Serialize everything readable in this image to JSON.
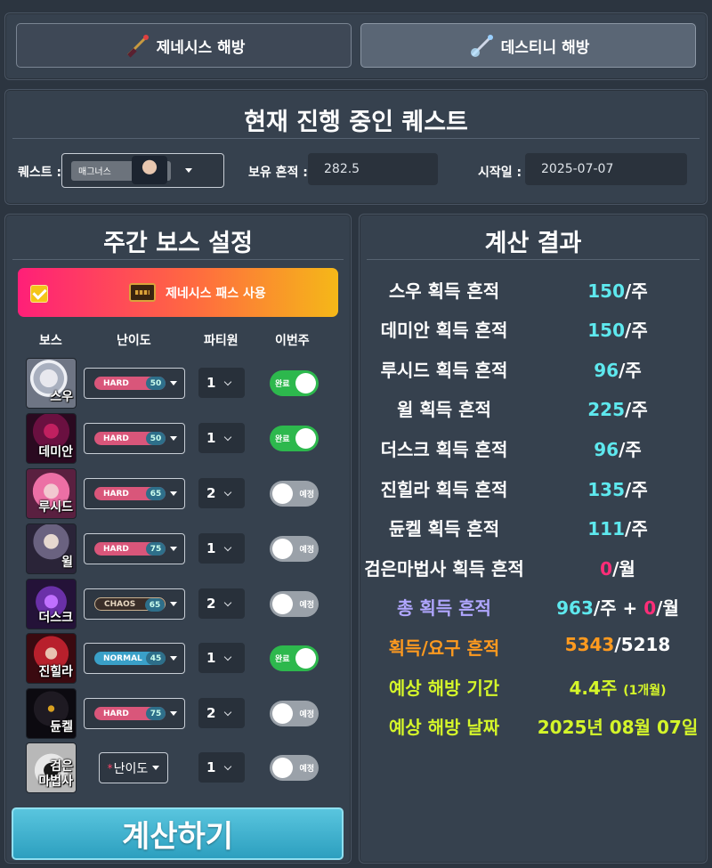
{
  "tabs": [
    {
      "label": "제네시스 해방",
      "icon": "genesis-weapon-icon"
    },
    {
      "label": "데스티니 해방",
      "icon": "destiny-weapon-icon"
    }
  ],
  "quest": {
    "title": "현재 진행 중인 퀘스트",
    "quest_label": "퀘스트 :",
    "quest_value": "매그너스",
    "owned_label": "보유 흔적 :",
    "owned_value": "282.5",
    "start_label": "시작일 :",
    "start_value": "2025-07-07"
  },
  "boss_settings": {
    "title": "주간 보스 설정",
    "genesis_pass_label": "제네시스 패스 사용",
    "genesis_pass_checked": true,
    "col_boss": "보스",
    "col_difficulty": "난이도",
    "col_party": "파티원",
    "col_this_week": "이번주",
    "rows": [
      {
        "name": "스우",
        "difficulty": "HARD",
        "level": "50",
        "party": "1",
        "toggle_label": "완료",
        "done": true
      },
      {
        "name": "데미안",
        "difficulty": "HARD",
        "level": "50",
        "party": "1",
        "toggle_label": "완료",
        "done": true
      },
      {
        "name": "루시드",
        "difficulty": "HARD",
        "level": "65",
        "party": "2",
        "toggle_label": "예정",
        "done": false
      },
      {
        "name": "윌",
        "difficulty": "HARD",
        "level": "75",
        "party": "1",
        "toggle_label": "예정",
        "done": false
      },
      {
        "name": "더스크",
        "difficulty": "CHAOS",
        "level": "65",
        "party": "2",
        "toggle_label": "예정",
        "done": false
      },
      {
        "name": "진힐라",
        "difficulty": "NORMAL",
        "level": "45",
        "party": "1",
        "toggle_label": "완료",
        "done": true
      },
      {
        "name": "듄켈",
        "difficulty": "HARD",
        "level": "75",
        "party": "2",
        "toggle_label": "예정",
        "done": false
      },
      {
        "name": "검은 마법사",
        "name_line1": "검은",
        "name_line2": "마법사",
        "difficulty_placeholder": "난이도",
        "required_mark": "*",
        "party": "1",
        "toggle_label": "예정",
        "done": false
      }
    ],
    "calculate_label": "계산하기"
  },
  "results": {
    "title": "계산 결과",
    "rows": [
      {
        "label": "스우 획득 흔적",
        "value": "150",
        "unit": "/주"
      },
      {
        "label": "데미안 획득 흔적",
        "value": "150",
        "unit": "/주"
      },
      {
        "label": "루시드 획득 흔적",
        "value": "96",
        "unit": "/주"
      },
      {
        "label": "윌 획득 흔적",
        "value": "225",
        "unit": "/주"
      },
      {
        "label": "더스크 획득 흔적",
        "value": "96",
        "unit": "/주"
      },
      {
        "label": "진힐라 획득 흔적",
        "value": "135",
        "unit": "/주"
      },
      {
        "label": "듄켈 획득 흔적",
        "value": "111",
        "unit": "/주"
      },
      {
        "label": "검은마법사 획득 흔적",
        "value": "0",
        "unit": "/월"
      }
    ],
    "total_label": "총 획득 흔적",
    "total_weekly": "963",
    "total_weekly_unit": "/주 + ",
    "total_monthly": "0",
    "total_monthly_unit": "/월",
    "progress_label": "획득/요구 흔적",
    "progress_have": "5343",
    "progress_need": "/5218",
    "period_label": "예상 해방 기간",
    "period_value": "4.4주",
    "period_sub": "(1개월)",
    "date_label": "예상 해방 날짜",
    "date_value": "2025년 08월 07일"
  },
  "colors": {
    "cyan": "#5ee8ee",
    "pink": "#ff2d78",
    "orange": "#ff9a1f",
    "lime": "#d4f52a",
    "violet": "#b0a6ff",
    "toggle_on": "#2db84d",
    "toggle_off": "#9aa1a9"
  }
}
